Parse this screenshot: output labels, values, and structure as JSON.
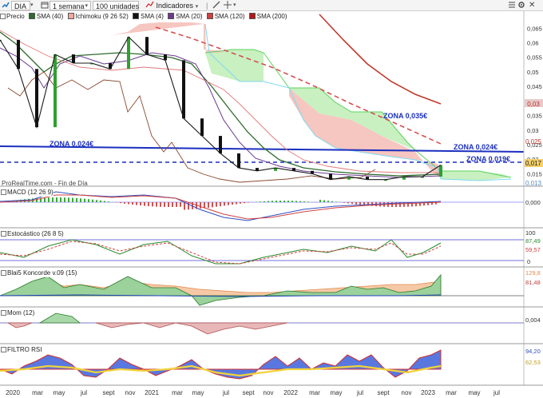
{
  "toolbar": {
    "symbol": "DIA",
    "period": "1 semana",
    "units": "100 unidades",
    "indicators": "Indicadores"
  },
  "legend": [
    {
      "label": "Precio",
      "color": "#1a7a1a"
    },
    {
      "label": "SMA (40)",
      "color": "#2d6b2d"
    },
    {
      "label": "Ichimoku (9 26 52)",
      "color": "#f4a7a0"
    },
    {
      "label": "SMA (4)",
      "color": "#111111"
    },
    {
      "label": "SMA (20)",
      "color": "#6a3a90"
    },
    {
      "label": "SMA (120)",
      "color": "#d14040"
    },
    {
      "label": "SMA (200)",
      "color": "#b01818"
    }
  ],
  "watermark": "ProRealTime.com - Fin de Día",
  "zones": {
    "z035": "ZONA 0,035€",
    "z024_left": "ZONA 0,024€",
    "z024_right": "ZONA 0,024€",
    "z019": "ZONA 0,019€"
  },
  "panels": {
    "macd": "MACD (12 26 9)",
    "estocastico": "Estocástico (26 8 5)",
    "koncorde": "Blai5 Koncorde v.09 (15)",
    "mom": "Mom (12)",
    "rsi": "FILTRO RSI"
  },
  "chart_data": {
    "type": "line",
    "title": "DIA",
    "xlabel": "",
    "ylabel": "",
    "x_ticks": [
      "2020",
      "mar",
      "may",
      "jul",
      "sept",
      "nov",
      "2021",
      "mar",
      "may",
      "jul",
      "sept",
      "nov",
      "2022",
      "mar",
      "may",
      "jul",
      "sept",
      "nov",
      "2023",
      "mar",
      "may",
      "jul"
    ],
    "y_ticks": [
      "0,065",
      "0,06",
      "0,055",
      "0,05",
      "0,045",
      "0,04",
      "0,035",
      "0,03",
      "0,025",
      "0,02",
      "0,015"
    ],
    "ylim": [
      0.011,
      0.067
    ],
    "x": [
      "2020-01",
      "2020-03",
      "2020-04",
      "2020-05",
      "2020-07",
      "2020-09",
      "2020-11",
      "2021-01",
      "2021-03",
      "2021-05",
      "2021-06",
      "2021-07",
      "2021-08",
      "2021-09",
      "2021-10",
      "2021-11",
      "2021-12",
      "2022-02",
      "2022-03",
      "2022-05",
      "2022-07",
      "2022-09",
      "2022-11",
      "2023-01",
      "2023-02"
    ],
    "series": [
      {
        "name": "Precio",
        "values": [
          0.061,
          0.051,
          0.031,
          0.056,
          0.053,
          0.053,
          0.051,
          0.062,
          0.056,
          0.054,
          0.034,
          0.028,
          0.022,
          0.017,
          0.016,
          0.017,
          0.016,
          0.015,
          0.013,
          0.014,
          0.013,
          0.013,
          0.014,
          0.014,
          0.018
        ]
      },
      {
        "name": "SMA (200)",
        "values": [
          null,
          null,
          null,
          null,
          null,
          null,
          null,
          null,
          null,
          null,
          null,
          null,
          null,
          null,
          0.064,
          0.06,
          0.055,
          0.05,
          0.046,
          0.042,
          0.04,
          0.038,
          0.037,
          0.036,
          0.035
        ]
      }
    ],
    "levels": [
      {
        "label": "ZONA 0,024€",
        "y": 0.024
      },
      {
        "label": "ZONA 0,019€",
        "y": 0.019
      },
      {
        "label": "ZONA 0,035€",
        "y": 0.035
      }
    ],
    "price_labels": [
      "0,03",
      "0,025",
      "0,017",
      "0,013"
    ],
    "grid": false,
    "legend_position": "top-left"
  },
  "right_axis": {
    "estocastico": [
      "100",
      "87,49",
      "59,57",
      "0"
    ],
    "koncorde": [
      "129,8",
      "81,48"
    ],
    "mom": [
      "0,004"
    ],
    "rsi": [
      "94,20",
      "62,53"
    ],
    "macd": [
      "0,000"
    ]
  }
}
